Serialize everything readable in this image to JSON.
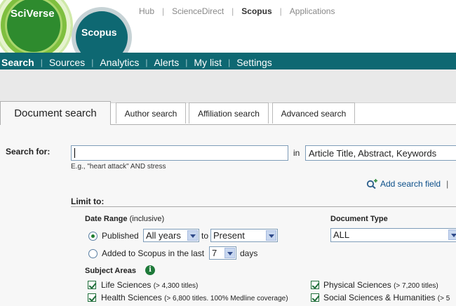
{
  "logos": {
    "sciverse": "SciVerse",
    "scopus": "Scopus"
  },
  "toplinks": [
    {
      "label": "Hub",
      "active": false
    },
    {
      "label": "ScienceDirect",
      "active": false
    },
    {
      "label": "Scopus",
      "active": true
    },
    {
      "label": "Applications",
      "active": false
    }
  ],
  "nav": {
    "items": [
      "Search",
      "Sources",
      "Analytics",
      "Alerts",
      "My list",
      "Settings"
    ],
    "active": "Search"
  },
  "tabs": [
    "Document search",
    "Author search",
    "Affiliation search",
    "Advanced search"
  ],
  "search": {
    "label": "Search for:",
    "value": "",
    "in_label": "in",
    "field": "Article Title, Abstract, Keywords",
    "example": "E.g., \"heart attack\" AND stress",
    "add_field": "Add search field",
    "add_sep": "|"
  },
  "limit": {
    "label": "Limit to:",
    "date_range_label": "Date Range",
    "date_range_note": "(inclusive)",
    "published_label": "Published",
    "from_value": "All years",
    "to_label": "to",
    "to_value": "Present",
    "added_label": "Added to Scopus in the last",
    "days_value": "7",
    "days_label": "days",
    "doc_type_label": "Document Type",
    "doc_type_value": "ALL"
  },
  "subjects": {
    "label": "Subject Areas",
    "info_glyph": "i",
    "items": [
      {
        "name": "Life Sciences",
        "note": "(> 4,300 titles)",
        "checked": true
      },
      {
        "name": "Physical Sciences",
        "note": "(> 7,200 titles)",
        "checked": true
      },
      {
        "name": "Health Sciences",
        "note": "(> 6,800 titles. 100% Medline coverage)",
        "checked": true
      },
      {
        "name": "Social Sciences & Humanities",
        "note": "(> 5",
        "checked": true
      }
    ]
  },
  "colors": {
    "brand_teal": "#0e6872",
    "link_blue": "#0b4f8a",
    "check_green": "#1f6e3a"
  }
}
